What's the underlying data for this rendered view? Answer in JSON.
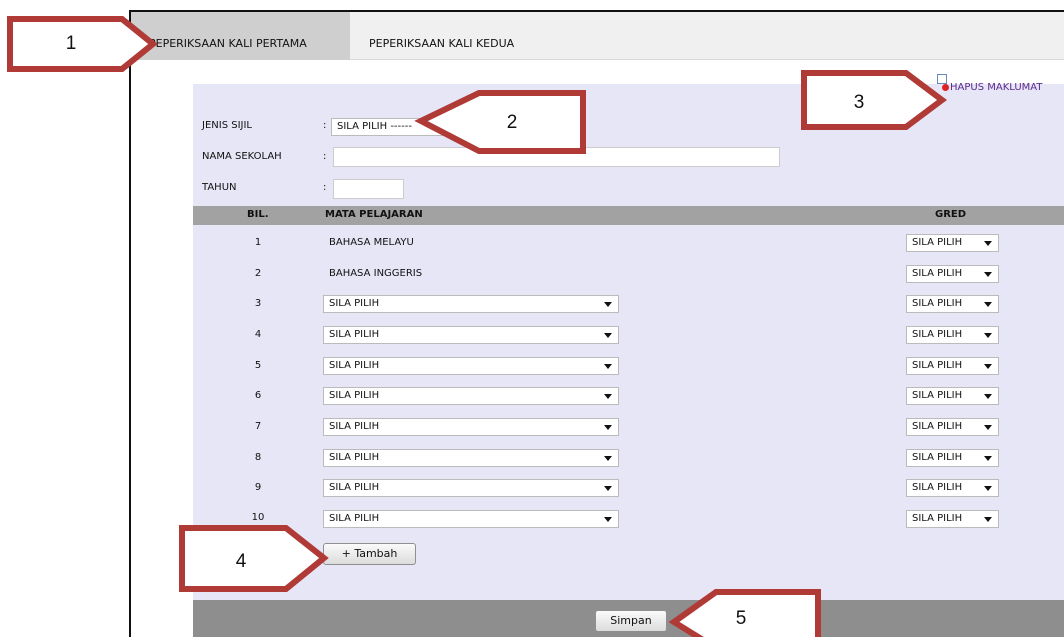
{
  "tabs": [
    {
      "label": "PEPERIKSAAN KALI PERTAMA"
    },
    {
      "label": "PEPERIKSAAN KALI KEDUA"
    }
  ],
  "hapus_label": "HAPUS MAKLUMAT",
  "form": {
    "jenis_label": "JENIS SIJIL",
    "jenis_value": "SILA PILIH ------",
    "nama_label": "NAMA SEKOLAH",
    "nama_value": "",
    "tahun_label": "TAHUN",
    "tahun_value": "",
    "colon": ":"
  },
  "table": {
    "headers": {
      "bil": "BIL.",
      "subject": "MATA PELAJARAN",
      "gred": "GRED"
    },
    "rows": [
      {
        "num": "1",
        "subject": "BAHASA MELAYU",
        "gred": "SILA PILIH"
      },
      {
        "num": "2",
        "subject": "BAHASA INGGERIS",
        "gred": "SILA PILIH"
      },
      {
        "num": "3",
        "subject": "SILA PILIH",
        "gred": "SILA PILIH"
      },
      {
        "num": "4",
        "subject": "SILA PILIH",
        "gred": "SILA PILIH"
      },
      {
        "num": "5",
        "subject": "SILA PILIH",
        "gred": "SILA PILIH"
      },
      {
        "num": "6",
        "subject": "SILA PILIH",
        "gred": "SILA PILIH"
      },
      {
        "num": "7",
        "subject": "SILA PILIH",
        "gred": "SILA PILIH"
      },
      {
        "num": "8",
        "subject": "SILA PILIH",
        "gred": "SILA PILIH"
      },
      {
        "num": "9",
        "subject": "SILA PILIH",
        "gred": "SILA PILIH"
      },
      {
        "num": "10",
        "subject": "SILA PILIH",
        "gred": "SILA PILIH"
      }
    ]
  },
  "buttons": {
    "tambah": "+ Tambah",
    "simpan": "Simpan"
  },
  "callouts": [
    "1",
    "2",
    "3",
    "4",
    "5"
  ],
  "colors": {
    "panel": "#e6e6f7",
    "header": "#a2a2a2",
    "callout_border": "#b03a36",
    "link": "#5b2b8c"
  }
}
